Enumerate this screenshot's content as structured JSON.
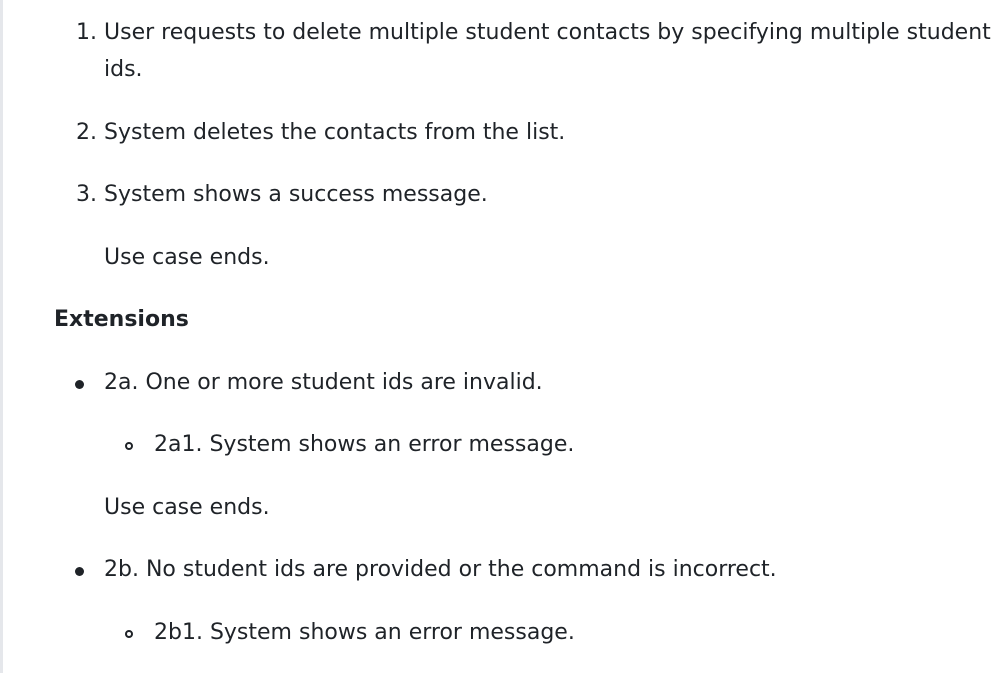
{
  "ordered_steps": [
    {
      "number": "1.",
      "line1": "User requests to delete multiple student contacts by specifying multiple student",
      "line2": "ids."
    },
    {
      "number": "2.",
      "line1": "System deletes the contacts from the list."
    },
    {
      "number": "3.",
      "line1": "System shows a success message."
    }
  ],
  "use_case_end_1": "Use case ends.",
  "extensions_heading": "Extensions",
  "extensions": [
    {
      "text": "2a. One or more student ids are invalid.",
      "sub": "2a1. System shows an error message.",
      "end": "Use case ends."
    },
    {
      "text": "2b. No student ids are provided or the command is incorrect.",
      "sub": "2b1. System shows an error message."
    }
  ]
}
